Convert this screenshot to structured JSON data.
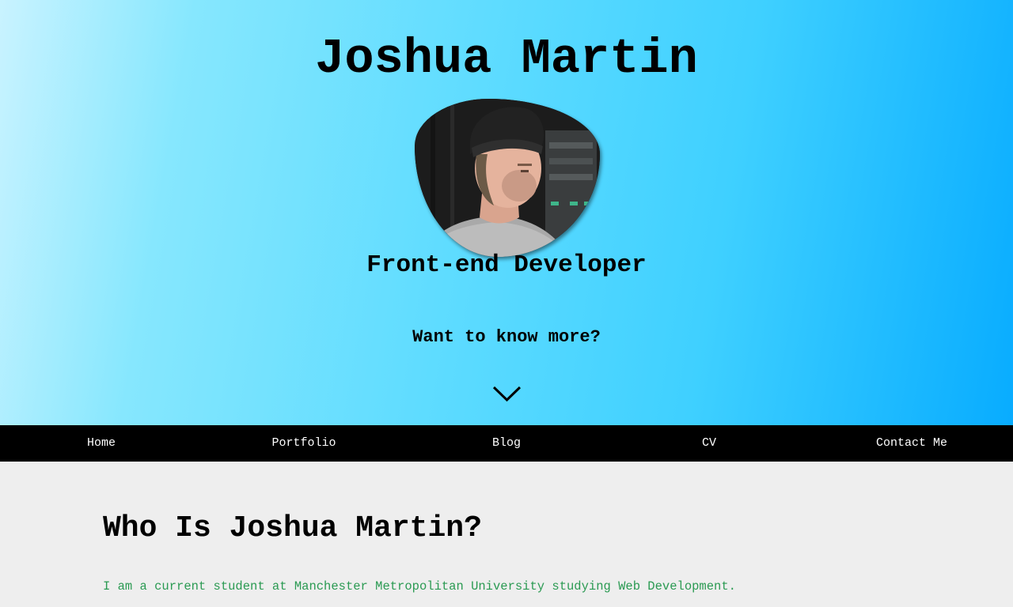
{
  "hero": {
    "title": "Joshua Martin",
    "subtitle": "Front-end Developer",
    "more_prompt": "Want to know more?",
    "scroll_icon": "chevron-down-icon"
  },
  "nav": {
    "items": [
      {
        "label": "Home"
      },
      {
        "label": "Portfolio"
      },
      {
        "label": "Blog"
      },
      {
        "label": "CV"
      },
      {
        "label": "Contact Me"
      }
    ]
  },
  "about": {
    "heading": "Who Is Joshua Martin?",
    "text": "I am a current student at Manchester Metropolitan University studying Web Development."
  },
  "colors": {
    "hero_gradient_start": "#c9f3ff",
    "hero_gradient_end": "#08acff",
    "nav_background": "#000000",
    "content_background": "#eeeeee",
    "body_text": "#2a9a52"
  }
}
